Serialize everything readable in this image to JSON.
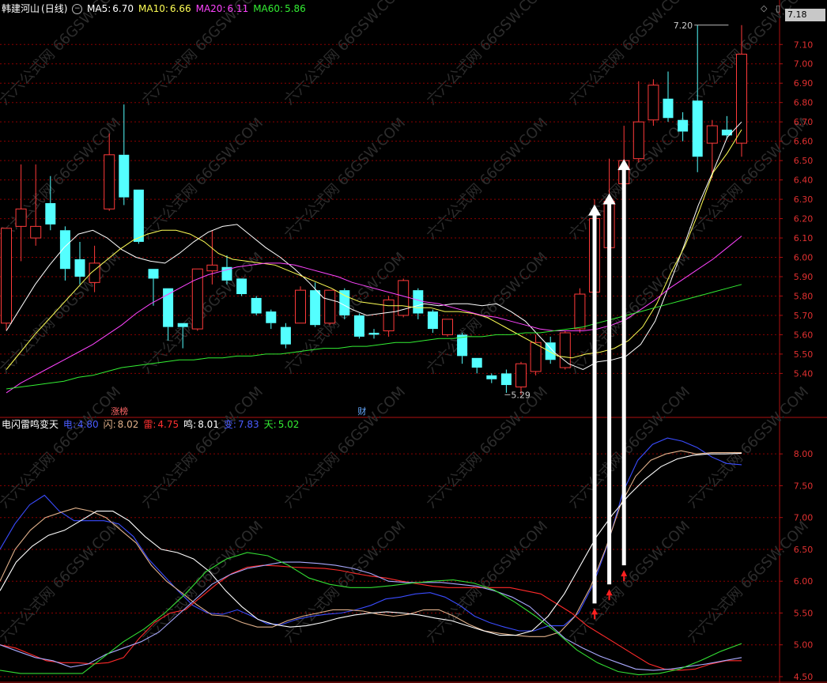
{
  "header": {
    "stock_name": "韩建河山",
    "period": "(日线)",
    "ma": [
      {
        "label": "MA5:",
        "value": "6.70",
        "color": "#ffffff"
      },
      {
        "label": "MA10:",
        "value": "6.66",
        "color": "#ffff55"
      },
      {
        "label": "MA20:",
        "value": "6.11",
        "color": "#ff44ff"
      },
      {
        "label": "MA60:",
        "value": "5.86",
        "color": "#33ee33"
      }
    ]
  },
  "indicator_header": {
    "name": "电闪雷鸣变天",
    "values": [
      {
        "label": "电:",
        "value": "4.80",
        "color": "#4a5cff"
      },
      {
        "label": "闪:",
        "value": "8.02",
        "color": "#e0b08a"
      },
      {
        "label": "雷:",
        "value": "4.75",
        "color": "#ff3030"
      },
      {
        "label": "鸣:",
        "value": "8.01",
        "color": "#ffffff"
      },
      {
        "label": "变:",
        "value": "7.83",
        "color": "#4a5cff"
      },
      {
        "label": "天:",
        "value": "5.02",
        "color": "#33ee33"
      }
    ]
  },
  "current_price_box": "7.18",
  "icons": {
    "diamond": "diamond-icon",
    "settings": "settings-icon"
  },
  "watermark": "六六公式网 66GSW.COM",
  "chart_data": [
    {
      "type": "candlestick",
      "title": "韩建河山(日线)",
      "ylim": [
        5.23,
        7.24
      ],
      "y_ticks": [
        5.4,
        5.5,
        5.6,
        5.7,
        5.8,
        5.9,
        6.0,
        6.1,
        6.2,
        6.3,
        6.4,
        6.5,
        6.6,
        6.7,
        6.8,
        6.9,
        7.0,
        7.1
      ],
      "y_tick_labels": [
        "5.40",
        "5.50",
        "5.60",
        "5.70",
        "5.80",
        "5.90",
        "6.00",
        "6.10",
        "6.20",
        "6.30",
        "6.40",
        "6.50",
        "6.60",
        "6.70",
        "6.80",
        "6.90",
        "7.00",
        "7.10"
      ],
      "candles": [
        {
          "o": 5.66,
          "c": 6.15,
          "h": 6.15,
          "l": 5.62
        },
        {
          "o": 6.16,
          "c": 6.25,
          "h": 6.48,
          "l": 5.98
        },
        {
          "o": 6.1,
          "c": 6.16,
          "h": 6.48,
          "l": 6.06
        },
        {
          "o": 6.28,
          "c": 6.17,
          "h": 6.42,
          "l": 6.14
        },
        {
          "o": 6.14,
          "c": 5.94,
          "h": 6.16,
          "l": 5.88
        },
        {
          "o": 5.99,
          "c": 5.9,
          "h": 6.08,
          "l": 5.86
        },
        {
          "o": 5.87,
          "c": 5.97,
          "h": 6.06,
          "l": 5.82
        },
        {
          "o": 6.25,
          "c": 6.53,
          "h": 6.64,
          "l": 6.24
        },
        {
          "o": 6.53,
          "c": 6.31,
          "h": 6.79,
          "l": 6.27
        },
        {
          "o": 6.35,
          "c": 6.08,
          "h": 6.35,
          "l": 6.07
        },
        {
          "o": 5.94,
          "c": 5.89,
          "h": 5.94,
          "l": 5.75
        },
        {
          "o": 5.84,
          "c": 5.64,
          "h": 5.84,
          "l": 5.57
        },
        {
          "o": 5.66,
          "c": 5.64,
          "h": 5.66,
          "l": 5.53
        },
        {
          "o": 5.63,
          "c": 5.94,
          "h": 5.94,
          "l": 5.62
        },
        {
          "o": 5.93,
          "c": 5.96,
          "h": 6.14,
          "l": 5.86
        },
        {
          "o": 5.95,
          "c": 5.88,
          "h": 6.01,
          "l": 5.86
        },
        {
          "o": 5.89,
          "c": 5.81,
          "h": 5.89,
          "l": 5.8
        },
        {
          "o": 5.79,
          "c": 5.71,
          "h": 5.8,
          "l": 5.7
        },
        {
          "o": 5.72,
          "c": 5.66,
          "h": 5.73,
          "l": 5.63
        },
        {
          "o": 5.64,
          "c": 5.55,
          "h": 5.66,
          "l": 5.53
        },
        {
          "o": 5.66,
          "c": 5.83,
          "h": 5.85,
          "l": 5.66
        },
        {
          "o": 5.83,
          "c": 5.65,
          "h": 5.87,
          "l": 5.64
        },
        {
          "o": 5.66,
          "c": 5.83,
          "h": 5.83,
          "l": 5.65
        },
        {
          "o": 5.83,
          "c": 5.7,
          "h": 5.84,
          "l": 5.68
        },
        {
          "o": 5.7,
          "c": 5.59,
          "h": 5.71,
          "l": 5.58
        },
        {
          "o": 5.61,
          "c": 5.6,
          "h": 5.63,
          "l": 5.58
        },
        {
          "o": 5.62,
          "c": 5.78,
          "h": 5.8,
          "l": 5.59
        },
        {
          "o": 5.7,
          "c": 5.88,
          "h": 5.89,
          "l": 5.69
        },
        {
          "o": 5.83,
          "c": 5.71,
          "h": 5.84,
          "l": 5.68
        },
        {
          "o": 5.72,
          "c": 5.63,
          "h": 5.73,
          "l": 5.61
        },
        {
          "o": 5.6,
          "c": 5.68,
          "h": 5.68,
          "l": 5.59
        },
        {
          "o": 5.6,
          "c": 5.49,
          "h": 5.61,
          "l": 5.45
        },
        {
          "o": 5.48,
          "c": 5.43,
          "h": 5.48,
          "l": 5.4
        },
        {
          "o": 5.39,
          "c": 5.37,
          "h": 5.4,
          "l": 5.35
        },
        {
          "o": 5.4,
          "c": 5.34,
          "h": 5.42,
          "l": 5.3
        },
        {
          "o": 5.33,
          "c": 5.45,
          "h": 5.46,
          "l": 5.29
        },
        {
          "o": 5.41,
          "c": 5.56,
          "h": 5.6,
          "l": 5.39
        },
        {
          "o": 5.56,
          "c": 5.47,
          "h": 5.59,
          "l": 5.45
        },
        {
          "o": 5.43,
          "c": 5.61,
          "h": 5.62,
          "l": 5.42
        },
        {
          "o": 5.63,
          "c": 5.81,
          "h": 5.84,
          "l": 5.61
        },
        {
          "o": 5.82,
          "c": 6.2,
          "h": 6.3,
          "l": 5.81
        },
        {
          "o": 6.05,
          "c": 6.29,
          "h": 6.51,
          "l": 6.04
        },
        {
          "o": 6.38,
          "c": 6.5,
          "h": 6.68,
          "l": 6.35
        },
        {
          "o": 6.51,
          "c": 6.7,
          "h": 6.91,
          "l": 6.49
        },
        {
          "o": 6.71,
          "c": 6.89,
          "h": 6.92,
          "l": 6.68
        },
        {
          "o": 6.82,
          "c": 6.72,
          "h": 6.96,
          "l": 6.7
        },
        {
          "o": 6.71,
          "c": 6.65,
          "h": 6.75,
          "l": 6.6
        },
        {
          "o": 6.81,
          "c": 6.52,
          "h": 7.2,
          "l": 6.44
        },
        {
          "o": 6.59,
          "c": 6.68,
          "h": 6.71,
          "l": 6.41
        },
        {
          "o": 6.66,
          "c": 6.63,
          "h": 6.73,
          "l": 6.61
        },
        {
          "o": 6.59,
          "c": 7.05,
          "h": 7.2,
          "l": 6.52
        }
      ],
      "ma_series": [
        {
          "name": "MA5",
          "values": [
            5.62,
            5.74,
            5.86,
            5.96,
            6.05,
            6.12,
            6.14,
            6.1,
            6.04,
            6.0,
            5.98,
            5.97,
            6.02,
            6.08,
            6.13,
            6.16,
            6.17,
            6.11,
            6.05,
            6.0,
            5.94,
            5.87,
            5.79,
            5.77,
            5.73,
            5.7,
            5.71,
            5.72,
            5.74,
            5.76,
            5.75,
            5.76,
            5.76,
            5.75,
            5.76,
            5.72,
            5.67,
            5.59,
            5.51,
            5.45,
            5.42,
            5.46,
            5.47,
            5.49,
            5.55,
            5.67,
            5.86,
            6.06,
            6.27,
            6.44,
            6.62,
            6.7
          ]
        },
        {
          "name": "MA10",
          "values": [
            5.42,
            5.51,
            5.6,
            5.68,
            5.76,
            5.84,
            5.92,
            5.98,
            6.04,
            6.09,
            6.12,
            6.14,
            6.14,
            6.12,
            6.08,
            6.02,
            5.99,
            5.98,
            5.97,
            5.96,
            5.93,
            5.9,
            5.87,
            5.84,
            5.8,
            5.77,
            5.76,
            5.75,
            5.75,
            5.74,
            5.74,
            5.72,
            5.72,
            5.71,
            5.69,
            5.65,
            5.61,
            5.57,
            5.53,
            5.49,
            5.48,
            5.5,
            5.51,
            5.53,
            5.57,
            5.64,
            5.76,
            5.92,
            6.06,
            6.24,
            6.44,
            6.54,
            6.66
          ]
        },
        {
          "name": "MA20",
          "values": [
            5.3,
            5.35,
            5.39,
            5.43,
            5.47,
            5.51,
            5.55,
            5.6,
            5.65,
            5.71,
            5.76,
            5.8,
            5.84,
            5.88,
            5.91,
            5.93,
            5.95,
            5.96,
            5.97,
            5.97,
            5.96,
            5.94,
            5.92,
            5.9,
            5.87,
            5.85,
            5.83,
            5.81,
            5.79,
            5.77,
            5.76,
            5.74,
            5.72,
            5.7,
            5.69,
            5.67,
            5.65,
            5.63,
            5.62,
            5.62,
            5.62,
            5.63,
            5.65,
            5.68,
            5.73,
            5.78,
            5.84,
            5.89,
            5.94,
            5.99,
            6.05,
            6.11
          ]
        },
        {
          "name": "MA60",
          "values": [
            5.32,
            5.33,
            5.34,
            5.35,
            5.36,
            5.38,
            5.39,
            5.41,
            5.43,
            5.44,
            5.45,
            5.46,
            5.47,
            5.47,
            5.48,
            5.48,
            5.49,
            5.49,
            5.5,
            5.5,
            5.51,
            5.52,
            5.53,
            5.53,
            5.54,
            5.54,
            5.55,
            5.56,
            5.56,
            5.57,
            5.58,
            5.58,
            5.59,
            5.59,
            5.6,
            5.6,
            5.61,
            5.61,
            5.62,
            5.63,
            5.64,
            5.66,
            5.68,
            5.7,
            5.72,
            5.74,
            5.76,
            5.78,
            5.8,
            5.82,
            5.84,
            5.86
          ]
        }
      ],
      "annotations": [
        {
          "text": "7.20",
          "x": 47,
          "y": 7.2
        },
        {
          "text": "5.29",
          "x": 34,
          "y": 5.29
        },
        {
          "text": "涨榜",
          "x": 7
        },
        {
          "text": "财",
          "x": 24
        }
      ]
    },
    {
      "type": "line",
      "title": "电闪雷鸣变天",
      "ylim": [
        4.45,
        8.35
      ],
      "y_ticks": [
        4.5,
        5.0,
        5.5,
        6.0,
        6.5,
        7.0,
        7.5,
        8.0
      ],
      "y_tick_labels": [
        "4.50",
        "5.00",
        "5.50",
        "6.00",
        "6.50",
        "7.00",
        "7.50",
        "8.00"
      ],
      "series": [
        {
          "name": "电",
          "color": "#3a4cff",
          "values": [
            6.5,
            6.9,
            7.2,
            7.35,
            7.1,
            6.95,
            6.95,
            6.95,
            6.9,
            6.7,
            6.35,
            6.1,
            5.85,
            5.62,
            5.5,
            5.48,
            5.55,
            5.45,
            5.33,
            5.32,
            5.4,
            5.45,
            5.48,
            5.5,
            5.55,
            5.62,
            5.72,
            5.75,
            5.8,
            5.82,
            5.75,
            5.62,
            5.45,
            5.35,
            5.28,
            5.22,
            5.22,
            5.3,
            5.3,
            5.5,
            5.95,
            6.6,
            7.4,
            7.9,
            8.15,
            8.25,
            8.2,
            8.1,
            7.95,
            7.85,
            7.83
          ]
        },
        {
          "name": "闪",
          "color": "#e0b08a",
          "values": [
            6.0,
            6.5,
            6.8,
            7.0,
            7.08,
            7.15,
            7.1,
            7.0,
            6.8,
            6.6,
            6.25,
            6.0,
            5.82,
            5.63,
            5.47,
            5.45,
            5.35,
            5.28,
            5.28,
            5.38,
            5.45,
            5.5,
            5.55,
            5.55,
            5.53,
            5.48,
            5.45,
            5.48,
            5.55,
            5.55,
            5.45,
            5.32,
            5.22,
            5.18,
            5.15,
            5.13,
            5.13,
            5.2,
            5.45,
            5.9,
            6.5,
            7.2,
            7.65,
            7.9,
            8.0,
            8.05,
            8.0,
            8.02,
            8.02,
            8.02
          ]
        },
        {
          "name": "雷",
          "color": "#ff2a2a",
          "values": [
            5.0,
            4.95,
            4.85,
            4.75,
            4.72,
            4.72,
            4.7,
            4.72,
            4.8,
            5.1,
            5.35,
            5.5,
            5.55,
            5.75,
            5.95,
            6.12,
            6.22,
            6.25,
            6.24,
            6.22,
            6.21,
            6.2,
            6.17,
            6.12,
            6.08,
            6.05,
            6.0,
            5.96,
            5.92,
            5.9,
            5.9,
            5.9,
            5.9,
            5.9,
            5.85,
            5.8,
            5.65,
            5.5,
            5.3,
            5.15,
            5.0,
            4.85,
            4.7,
            4.62,
            4.6,
            4.62,
            4.7,
            4.75,
            4.75
          ]
        },
        {
          "name": "鸣",
          "color": "#ffffff",
          "values": [
            5.85,
            6.3,
            6.55,
            6.72,
            6.8,
            6.95,
            7.1,
            7.1,
            6.95,
            6.7,
            6.5,
            6.45,
            6.35,
            6.15,
            5.85,
            5.6,
            5.4,
            5.32,
            5.28,
            5.3,
            5.35,
            5.42,
            5.47,
            5.5,
            5.52,
            5.5,
            5.47,
            5.42,
            5.38,
            5.3,
            5.22,
            5.15,
            5.15,
            5.22,
            5.45,
            5.8,
            6.25,
            6.7,
            7.05,
            7.35,
            7.6,
            7.8,
            7.92,
            7.98,
            8.0,
            8.0,
            8.01
          ]
        },
        {
          "name": "变",
          "color": "#aaaaff",
          "values": [
            5.0,
            4.9,
            4.8,
            4.75,
            4.65,
            4.7,
            4.85,
            4.95,
            5.05,
            5.2,
            5.45,
            5.7,
            5.95,
            6.1,
            6.2,
            6.25,
            6.3,
            6.3,
            6.28,
            6.25,
            6.2,
            6.12,
            6.0,
            5.98,
            5.98,
            5.98,
            5.95,
            5.92,
            5.85,
            5.75,
            5.6,
            5.35,
            5.1,
            4.95,
            4.82,
            4.72,
            4.62,
            4.6,
            4.62,
            4.66,
            4.7,
            4.75,
            4.8
          ]
        },
        {
          "name": "天",
          "color": "#33dd33",
          "values": [
            4.6,
            4.55,
            4.55,
            4.55,
            4.55,
            4.8,
            5.05,
            5.25,
            5.5,
            5.8,
            6.15,
            6.35,
            6.45,
            6.4,
            6.25,
            6.05,
            5.95,
            5.9,
            5.9,
            5.93,
            5.97,
            6.0,
            6.02,
            5.97,
            5.86,
            5.67,
            5.45,
            5.2,
            4.92,
            4.72,
            4.58,
            4.53,
            4.55,
            4.62,
            4.75,
            4.9,
            5.02
          ]
        }
      ],
      "buy_signals": [
        40,
        41,
        42
      ]
    }
  ]
}
